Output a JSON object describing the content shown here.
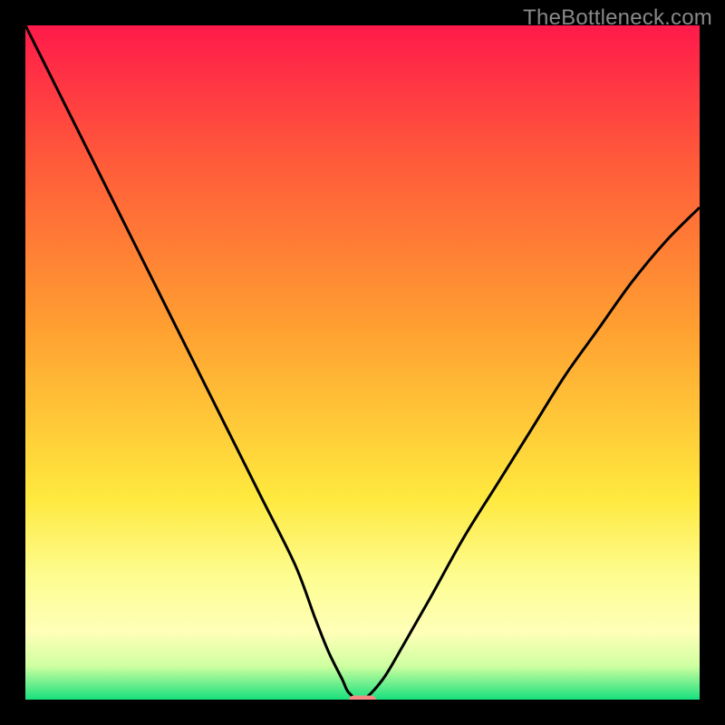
{
  "watermark": "TheBottleneck.com",
  "colors": {
    "frame": "#000000",
    "watermark": "#888888",
    "curve": "#000000",
    "marker": "#f58b84",
    "gradient_stops": [
      {
        "offset": 0.0,
        "color": "#ff1a4a"
      },
      {
        "offset": 0.2,
        "color": "#ff5a3a"
      },
      {
        "offset": 0.45,
        "color": "#ffa031"
      },
      {
        "offset": 0.7,
        "color": "#ffe93e"
      },
      {
        "offset": 0.82,
        "color": "#fdfd92"
      },
      {
        "offset": 0.9,
        "color": "#ffffb8"
      },
      {
        "offset": 0.95,
        "color": "#cfffa0"
      },
      {
        "offset": 1.0,
        "color": "#18e07e"
      }
    ]
  },
  "chart_data": {
    "type": "line",
    "title": "",
    "xlabel": "",
    "ylabel": "",
    "xlim": [
      0,
      100
    ],
    "ylim": [
      0,
      100
    ],
    "series": [
      {
        "name": "bottleneck-curve",
        "x": [
          0,
          5,
          10,
          15,
          20,
          25,
          30,
          35,
          40,
          43,
          45,
          47,
          48,
          50,
          53,
          56,
          60,
          65,
          70,
          75,
          80,
          85,
          90,
          95,
          100
        ],
        "y": [
          100,
          90,
          80,
          70,
          60,
          50,
          40,
          30,
          20,
          12,
          7,
          3,
          1,
          0,
          3,
          8,
          15,
          24,
          32,
          40,
          48,
          55,
          62,
          68,
          73
        ]
      }
    ],
    "marker": {
      "x": 50,
      "y": 0,
      "width_frac": 0.04,
      "height_frac": 0.012
    }
  }
}
